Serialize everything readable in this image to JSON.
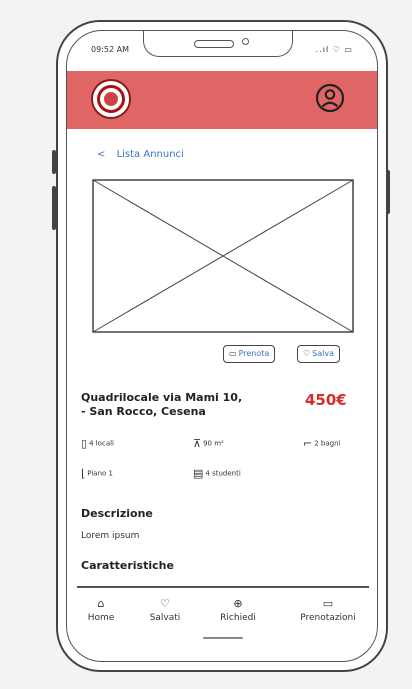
{
  "status_bar": {
    "time": "09:52 AM",
    "icons": "..ıl ♡ ▭"
  },
  "header": {
    "logo_icon": "university-seal-icon",
    "profile_icon": "user-profile-icon",
    "color": "#e06666"
  },
  "back_link": {
    "label": "Lista Annunci",
    "icon": "chevron-left-icon"
  },
  "actions": {
    "book_label": "Prenota",
    "save_label": "Salva"
  },
  "listing": {
    "title_line1": "Quadrilocale via Mami 10,",
    "title_line2": "- San Rocco, Cesena",
    "price": "450€"
  },
  "features": {
    "rooms": "4 locali",
    "area": "90 m²",
    "baths": "2 bagni",
    "floor": "Piano 1",
    "occupants": "4 studenti"
  },
  "description": {
    "title": "Descrizione",
    "text": "Lorem ipsum"
  },
  "characteristics": {
    "title": "Caratteristiche"
  },
  "nav": {
    "home": "Home",
    "saved": "Salvati",
    "requests": "Richiedi",
    "bookings": "Prenotazioni"
  }
}
